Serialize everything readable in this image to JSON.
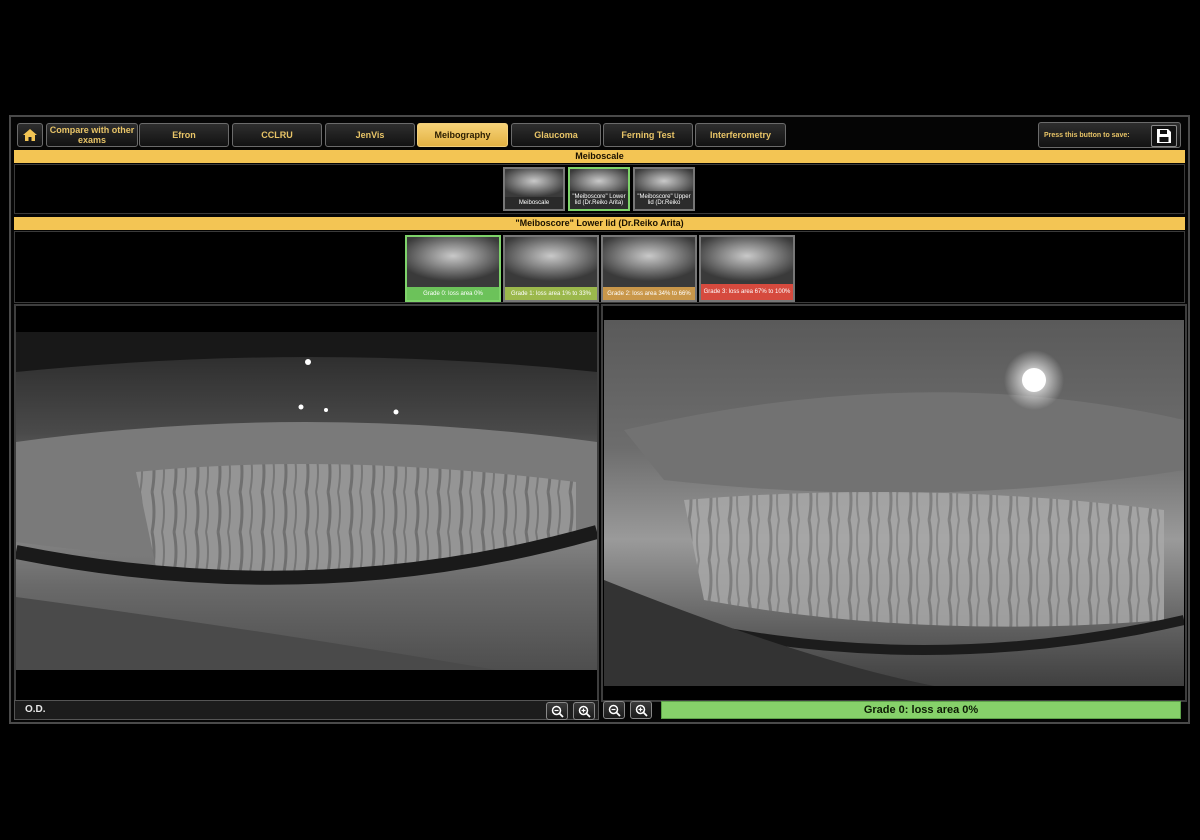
{
  "toolbar": {
    "home_icon": "home-icon",
    "tabs": [
      {
        "label": "Compare with other exams",
        "active": false
      },
      {
        "label": "Efron",
        "active": false
      },
      {
        "label": "CCLRU",
        "active": false
      },
      {
        "label": "JenVis",
        "active": false
      },
      {
        "label": "Meibography",
        "active": true
      },
      {
        "label": "Glaucoma",
        "active": false
      },
      {
        "label": "Ferning Test",
        "active": false
      },
      {
        "label": "Interferometry",
        "active": false
      }
    ],
    "save_prompt": "Press this button to save:",
    "save_icon": "floppy-disk-icon"
  },
  "meiboscale": {
    "header": "Meiboscale",
    "thumbnails": [
      {
        "caption": "Meiboscale",
        "selected": false
      },
      {
        "caption": "\"Meiboscore\" Lower lid (Dr.Reiko Arita)",
        "selected": true
      },
      {
        "caption": "\"Meiboscore\" Upper lid (Dr.Reiko",
        "selected": false
      }
    ]
  },
  "meiboscore": {
    "header": "\"Meiboscore\" Lower lid (Dr.Reiko Arita)",
    "grades": [
      {
        "caption": "Grade 0: loss area 0%",
        "color": "#6cc25a"
      },
      {
        "caption": "Grade 1: loss area 1% to 33%",
        "color": "#9bb84c"
      },
      {
        "caption": "Grade 2: loss area 34% to 66%",
        "color": "#c9974a"
      },
      {
        "caption": "Grade 3: loss area 67% to 100%",
        "color": "#d64a3e"
      }
    ]
  },
  "viewer": {
    "eye_label": "O.D.",
    "zoom_in_icon": "zoom-in-icon",
    "zoom_out_icon": "zoom-out-icon",
    "grade_result": "Grade 0: loss area 0%"
  },
  "colors": {
    "accent": "#f3c554",
    "grade_ok": "#86d16a"
  }
}
